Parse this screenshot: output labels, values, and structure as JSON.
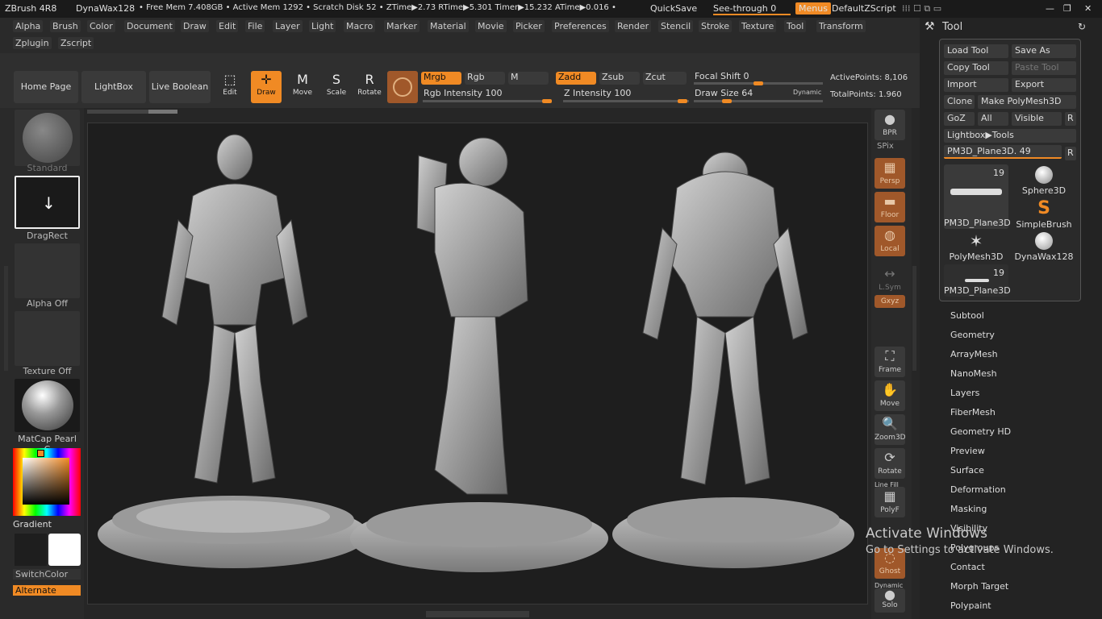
{
  "titlebar": {
    "app": "ZBrush 4R8",
    "project": "DynaWax128",
    "stats": "• Free Mem 7.408GB • Active Mem 1292 • Scratch Disk 52 • ZTime▶2.73 RTime▶5.301 Timer▶15.232 ATime▶0.016 •",
    "quicksave": "QuickSave",
    "seethrough": "See-through  0",
    "menus": "Menus",
    "script": "DefaultZScript"
  },
  "menus": {
    "row1": [
      "Alpha",
      "Brush",
      "Color",
      "Document",
      "Draw",
      "Edit",
      "File",
      "Layer",
      "Light",
      "Macro",
      "Marker",
      "Material",
      "Movie",
      "Picker",
      "Preferences",
      "Render",
      "Stencil",
      "Stroke",
      "Texture",
      "Tool",
      "Transform"
    ],
    "row2": [
      "Zplugin",
      "Zscript"
    ]
  },
  "toolbar": {
    "home": "Home Page",
    "lightbox": "LightBox",
    "liveboolean": "Live Boolean",
    "edit": "Edit",
    "draw": "Draw",
    "move": "Move",
    "scale": "Scale",
    "rotate": "Rotate",
    "mrgb": "Mrgb",
    "rgb": "Rgb",
    "m": "M",
    "zadd": "Zadd",
    "zsub": "Zsub",
    "zcut": "Zcut",
    "rgb_intensity": "Rgb Intensity 100",
    "z_intensity": "Z Intensity 100",
    "focal_shift": "Focal Shift 0",
    "draw_size": "Draw Size 64",
    "dynamic": "Dynamic",
    "active_points": "ActivePoints: 8,106",
    "total_points": "TotalPoints: 1.960"
  },
  "left": {
    "standard": "Standard",
    "dragrect": "DragRect",
    "alpha": "Alpha Off",
    "texture": "Texture Off",
    "matcap": "MatCap Pearl C",
    "gradient": "Gradient",
    "switchcolor": "SwitchColor",
    "alternate": "Alternate"
  },
  "shelf": {
    "bpr": "BPR",
    "spix": "SPix",
    "persp": "Persp",
    "floor": "Floor",
    "local": "Local",
    "lsym": "L.Sym",
    "xyz": "Gxyz",
    "frame": "Frame",
    "move": "Move",
    "zoom": "Zoom3D",
    "rotate": "Rotate",
    "linefill": "Line Fill",
    "polyf": "PolyF",
    "ghost": "Ghost",
    "dynamic": "Dynamic",
    "solo": "Solo"
  },
  "tool": {
    "header": "Tool",
    "load": "Load Tool",
    "saveas": "Save As",
    "copy": "Copy Tool",
    "paste": "Paste Tool",
    "import": "Import",
    "export": "Export",
    "clone": "Clone",
    "makepoly": "Make PolyMesh3D",
    "goz": "GoZ",
    "all": "All",
    "visible": "Visible",
    "r": "R",
    "lightbox_tools": "Lightbox▶Tools",
    "current": "PM3D_Plane3D. 49",
    "thumbs": [
      {
        "name": "PM3D_Plane3D",
        "count": "19"
      },
      {
        "name": "Sphere3D",
        "count": ""
      },
      {
        "name": "",
        "count": ""
      },
      {
        "name": "SimpleBrush",
        "count": ""
      },
      {
        "name": "PolyMesh3D",
        "count": ""
      },
      {
        "name": "DynaWax128",
        "count": ""
      },
      {
        "name": "PM3D_Plane3D",
        "count": "19"
      }
    ],
    "sections": [
      "Subtool",
      "Geometry",
      "ArrayMesh",
      "NanoMesh",
      "Layers",
      "FiberMesh",
      "Geometry HD",
      "Preview",
      "Surface",
      "Deformation",
      "Masking",
      "Visibility",
      "Polygroups",
      "Contact",
      "Morph Target",
      "Polypaint"
    ]
  },
  "watermark": {
    "line1": "Activate Windows",
    "line2": "Go to Settings to activate Windows."
  }
}
